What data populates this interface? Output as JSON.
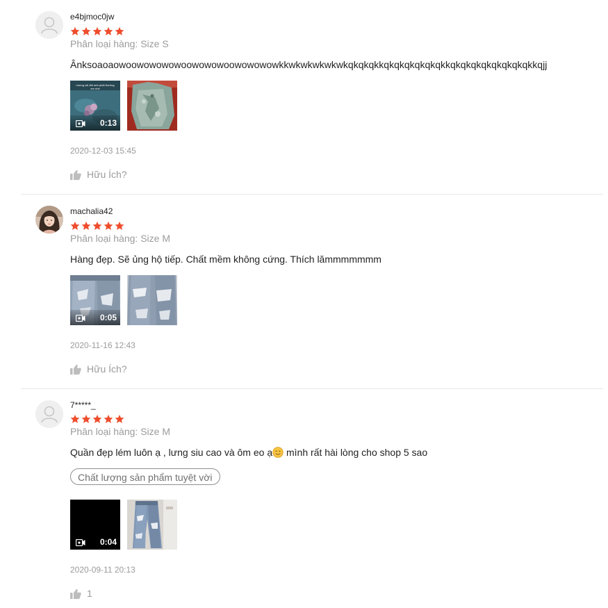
{
  "reviews": [
    {
      "username": "e4bjmoc0jw",
      "rating": 5,
      "variation": "Phân loại hàng: Size S",
      "content": "Ânksoaoaowoowowowowoowowowoowowowowkkwkwkwkwkwkqkqkqkkqkqkqkqkqkqkkqkqkqkqkqkqkqkqkkqjj",
      "media": [
        {
          "type": "video",
          "duration": "0:13",
          "caption": "nhưng cái đời anh phải thường em nhé"
        },
        {
          "type": "image"
        }
      ],
      "timestamp": "2020-12-03 15:45",
      "helpful_label": "Hữu Ích?"
    },
    {
      "username": "machalia42",
      "rating": 5,
      "variation": "Phân loại hàng: Size M",
      "content": "Hàng đẹp. Sẽ ủng hộ tiếp. Chất mềm không cứng. Thích lămmmmmmm",
      "media": [
        {
          "type": "video",
          "duration": "0:05"
        },
        {
          "type": "image"
        }
      ],
      "timestamp": "2020-11-16 12:43",
      "helpful_label": "Hữu Ích?"
    },
    {
      "username": "7*****_",
      "rating": 5,
      "variation": "Phân loại hàng: Size M",
      "content_before": "Quần đẹp lém luôn ạ , lưng siu cao và ôm eo ạ",
      "content_after": " mình rất hài lòng cho shop 5 sao",
      "tag": "Chất lượng sản phẩm tuyệt vời",
      "media": [
        {
          "type": "video",
          "duration": "0:04"
        },
        {
          "type": "image"
        }
      ],
      "timestamp": "2020-09-11 20:13",
      "helpful_count": "1"
    }
  ],
  "colors": {
    "star": "#ee4d2d",
    "muted": "#9b9b9b",
    "divider": "#e8e8e8"
  },
  "icons": {
    "avatar_placeholder": "user-silhouette-icon",
    "star": "star-icon",
    "video": "video-camera-icon",
    "helpful": "thumbs-up-icon",
    "emoji": "smiling-face-emoji-icon"
  }
}
